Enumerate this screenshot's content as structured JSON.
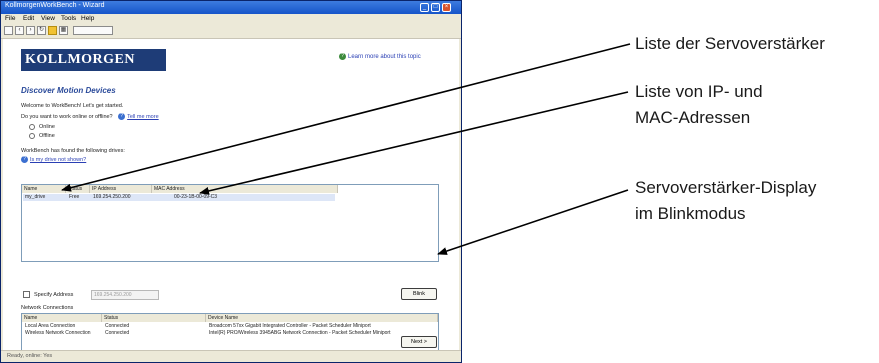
{
  "window": {
    "title": "KollmorgenWorkBench - Wizard",
    "menu": [
      "File",
      "Edit",
      "View",
      "Tools",
      "Help"
    ]
  },
  "brand": {
    "logo_text": "KOLLMORGEN"
  },
  "learn_more": "Learn more about this topic",
  "page": {
    "heading": "Discover Motion Devices",
    "welcome": "Welcome to WorkBench! Let's get started.",
    "question": "Do you want to work online or offline?",
    "tell_me_more": "Tell me more",
    "online_label": "Online",
    "offline_label": "Offline",
    "found_text": "WorkBench has found the following drives:",
    "drive_not_shown": "Is my drive not shown?"
  },
  "drives_table": {
    "columns": [
      "Name",
      "Status",
      "IP Address",
      "MAC Address"
    ],
    "rows": [
      [
        "my_drive",
        "Free",
        "169.254.250.200",
        "00-23-1B-00-09-C3"
      ]
    ]
  },
  "specify_address": {
    "label": "Specify Address",
    "placeholder": "169.254.250.200"
  },
  "blink_button": "Blink",
  "network_connections": {
    "title": "Network Connections",
    "columns": [
      "Name",
      "Status",
      "Device Name"
    ],
    "rows": [
      [
        "Local Area Connection",
        "Connected",
        "Broadcom 57xx Gigabit Integrated Controller - Packet Scheduler Miniport"
      ],
      [
        "Wireless Network Connection",
        "Connected",
        "Intel(R) PRO/Wireless 3945ABG Network Connection - Packet Scheduler Miniport"
      ]
    ]
  },
  "next_button": "Next >",
  "status_bar": "Ready, online: Yes",
  "annotations": {
    "drive_list": "Liste der Servoverstärker",
    "ip_mac_line1": "Liste von IP- und",
    "ip_mac_line2": "MAC-Adressen",
    "blink_line1": "Servoverstärker-Display",
    "blink_line2": "im Blinkmodus"
  }
}
